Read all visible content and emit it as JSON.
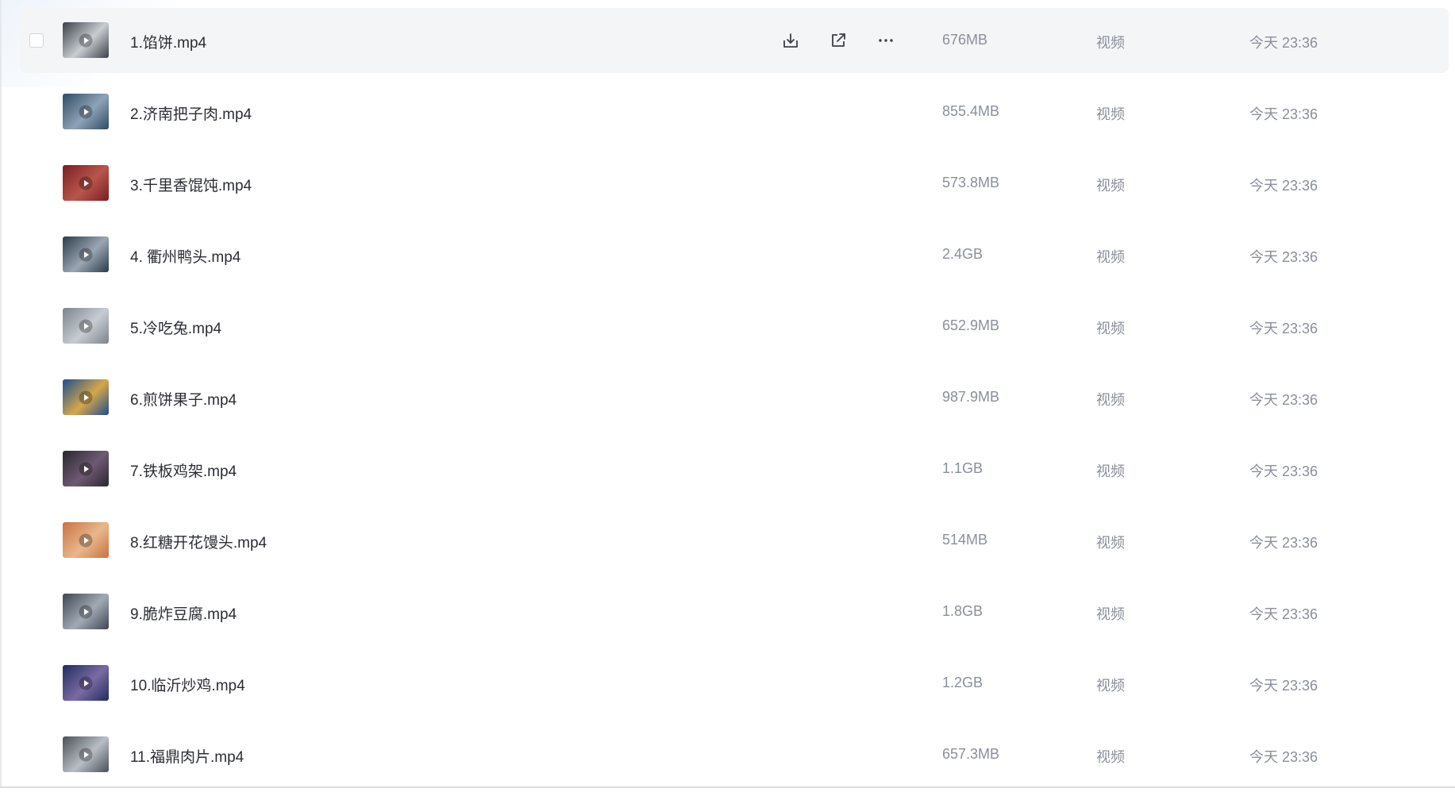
{
  "files": [
    {
      "name": "1.馅饼.mp4",
      "size": "676MB",
      "type": "视频",
      "modified": "今天 23:36",
      "hovered": true,
      "thumb_colors": [
        "#3a4048",
        "#c9cdd2"
      ]
    },
    {
      "name": "2.济南把子肉.mp4",
      "size": "855.4MB",
      "type": "视频",
      "modified": "今天 23:36",
      "hovered": false,
      "thumb_colors": [
        "#2f4b63",
        "#8fa3b6"
      ]
    },
    {
      "name": "3.千里香馄饨.mp4",
      "size": "573.8MB",
      "type": "视频",
      "modified": "今天 23:36",
      "hovered": false,
      "thumb_colors": [
        "#7a1e22",
        "#b8564c"
      ]
    },
    {
      "name": "4. 衢州鸭头.mp4",
      "size": "2.4GB",
      "type": "视频",
      "modified": "今天 23:36",
      "hovered": false,
      "thumb_colors": [
        "#2c3a4a",
        "#9aa6b2"
      ]
    },
    {
      "name": "5.冷吃兔.mp4",
      "size": "652.9MB",
      "type": "视频",
      "modified": "今天 23:36",
      "hovered": false,
      "thumb_colors": [
        "#7c838c",
        "#c7ccd2"
      ]
    },
    {
      "name": "6.煎饼果子.mp4",
      "size": "987.9MB",
      "type": "视频",
      "modified": "今天 23:36",
      "hovered": false,
      "thumb_colors": [
        "#1d4e8f",
        "#d6a74a"
      ]
    },
    {
      "name": "7.铁板鸡架.mp4",
      "size": "1.1GB",
      "type": "视频",
      "modified": "今天 23:36",
      "hovered": false,
      "thumb_colors": [
        "#2b2730",
        "#6d5a72"
      ]
    },
    {
      "name": "8.红糖开花馒头.mp4",
      "size": "514MB",
      "type": "视频",
      "modified": "今天 23:36",
      "hovered": false,
      "thumb_colors": [
        "#c9733f",
        "#e8b78c"
      ]
    },
    {
      "name": "9.脆炸豆腐.mp4",
      "size": "1.8GB",
      "type": "视频",
      "modified": "今天 23:36",
      "hovered": false,
      "thumb_colors": [
        "#3e4651",
        "#a2abb5"
      ]
    },
    {
      "name": "10.临沂炒鸡.mp4",
      "size": "1.2GB",
      "type": "视频",
      "modified": "今天 23:36",
      "hovered": false,
      "thumb_colors": [
        "#1f2d5c",
        "#7b6aa3"
      ]
    },
    {
      "name": "11.福鼎肉片.mp4",
      "size": "657.3MB",
      "type": "视频",
      "modified": "今天 23:36",
      "hovered": false,
      "thumb_colors": [
        "#4a4f57",
        "#b9bec5"
      ]
    }
  ],
  "icons": {
    "download": "download-icon",
    "share": "share-icon",
    "more": "more-icon",
    "play": "play-icon"
  },
  "colors": {
    "hover_row_bg": "#f4f5f7",
    "name_text": "#2b2d33",
    "meta_text": "#8a8f99",
    "icon_stroke": "#3b3f46"
  }
}
